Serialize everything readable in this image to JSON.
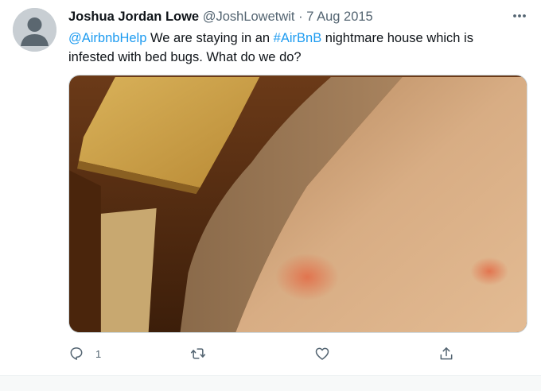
{
  "tweet": {
    "author_name": "Joshua Jordan Lowe",
    "author_handle": "@JoshLowetwit",
    "separator": "·",
    "date": "7 Aug 2015",
    "text_mention": "@AirbnbHelp",
    "text_part1": " We are staying in an ",
    "text_hashtag": "#AirBnB",
    "text_part2": " nightmare house which is infested with bed bugs. What do we do?"
  },
  "media": {
    "icon": "photo-image"
  },
  "actions": {
    "reply_count": "1",
    "icons": [
      "reply-icon",
      "retweet-icon",
      "like-icon",
      "share-icon"
    ]
  },
  "colors": {
    "link": "#1d9bf0",
    "secondary_text": "#536471",
    "icon": "#536471"
  }
}
